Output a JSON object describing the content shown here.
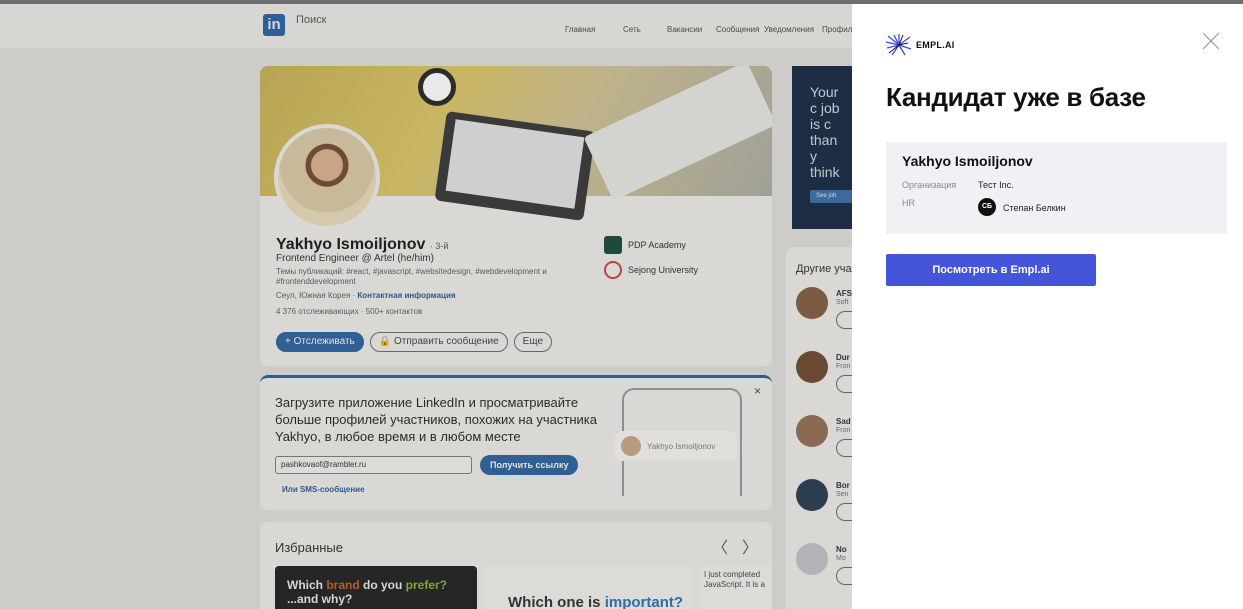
{
  "linkedin": {
    "logo": "in",
    "search_placeholder": "Поиск",
    "nav": [
      "Главная",
      "Сеть",
      "Вакансии",
      "Сообщения",
      "Уведомления",
      "Профиль"
    ],
    "profile": {
      "name": "Yakhyo Ismoiljonov",
      "degree": "· 3-й",
      "headline": "Frontend Engineer @ Artel (he/him)",
      "topics": "Темы публикаций: #react, #javascript, #websitedesign, #webdevelopment и #frontenddevelopment",
      "location": "Сеул, Южная Корея ·",
      "contact_link": "Контактная информация",
      "followers": "4 376 отслеживающих · 500+ контактов",
      "follow_button": "+ Отслеживать",
      "message_button": "🔒 Отправить сообщение",
      "more_button": "Еще",
      "education": [
        {
          "name": "PDP Academy",
          "color": "#1e4a3a"
        },
        {
          "name": "Sejong University",
          "color": "#b8473a"
        }
      ]
    },
    "promo": {
      "title": "Загрузите приложение LinkedIn и просматривайте больше профилей участников, похожих на участника Yakhyo, в любое время и в любом месте",
      "email_value": "pashkovaof@rambler.ru",
      "get_link_button": "Получить ссылку",
      "sms_link": "Или SMS-сообщение",
      "phone_chip": "Yakhyo Ismoiljonov",
      "close": "×"
    },
    "featured": {
      "title": "Избранные",
      "arrows": "〈〉",
      "tile1_a": "Which ",
      "tile1_brand": "brand",
      "tile1_b": " do you ",
      "tile1_prefer": "prefer?",
      "tile1_c": "...and why?",
      "tile2_a": "Which one is ",
      "tile2_b": "important?",
      "tile3": "I just completed JavaScript. It is a"
    },
    "ad": {
      "text": "Your c job is c than y think",
      "button": "See job"
    },
    "others": {
      "title": "Другие участники",
      "people": [
        {
          "name": "AFS",
          "sub": "Soft",
          "color": "#7a5a40"
        },
        {
          "name": "Dur",
          "sub": "Fron",
          "color": "#6a4a32"
        },
        {
          "name": "Sad",
          "sub": "Fron",
          "color": "#8a6a50"
        },
        {
          "name": "Bor",
          "sub": "Sen",
          "color": "#2c3e50"
        },
        {
          "name": "No",
          "sub": "Mo",
          "color": "#b0b4b8"
        }
      ]
    }
  },
  "panel": {
    "brand": "EMPL.AI",
    "heading": "Кандидат уже в базе",
    "candidate_name": "Yakhyo Ismoiljonov",
    "org_label": "Организация",
    "org_value": "Тест Inc.",
    "hr_label": "HR",
    "hr_initials": "СБ",
    "hr_name": "Степан Белкин",
    "cta": "Посмотреть в Empl.ai"
  }
}
